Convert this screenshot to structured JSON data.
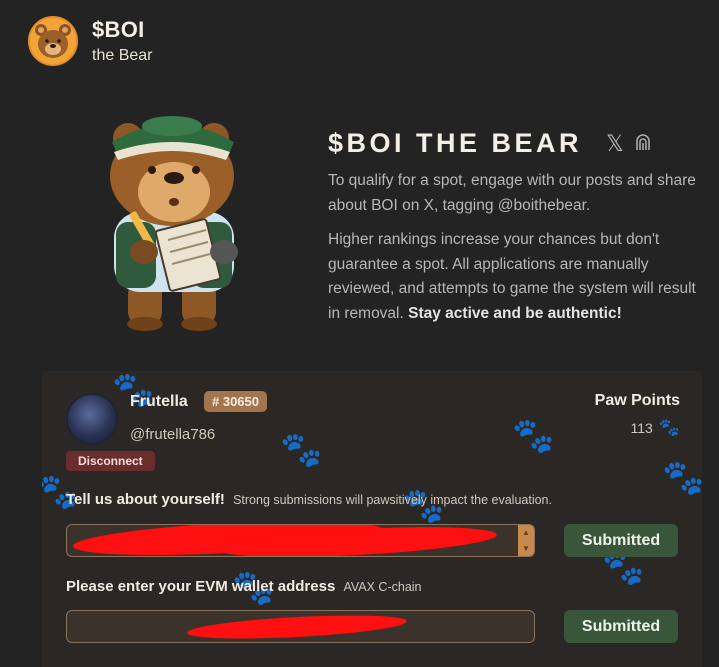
{
  "brand": {
    "title": "$BOI",
    "subtitle": "the Bear",
    "logo_icon": "bear-face-icon"
  },
  "hero": {
    "title": "$BOI THE BEAR",
    "social_icons": [
      "x-logo-icon",
      "qr-fingerprint-icon"
    ],
    "paragraph1": "To qualify for a spot, engage with our posts and share about BOI on X, tagging @boithebear.",
    "paragraph2": "Higher rankings increase your chances but don't guarantee a spot. All applications are manually reviewed, and attempts to game the system will result in removal.",
    "paragraph2_strong": "Stay active and be authentic!",
    "image_icon": "bear-mascot-writing-icon"
  },
  "profile": {
    "name": "Frutella",
    "rank": "# 30650",
    "handle": "@frutella786",
    "disconnect_label": "Disconnect",
    "points_label": "Paw Points",
    "points_value": "113"
  },
  "form": {
    "about_label": "Tell us about yourself!",
    "about_hint": "Strong submissions will pawsitively impact the evaluation.",
    "wallet_label": "Please enter your EVM wallet address",
    "wallet_hint": "AVAX C-chain",
    "submit_label_1": "Submitted",
    "submit_label_2": "Submitted"
  },
  "colors": {
    "background": "#232323",
    "card": "#2b2724",
    "rank_badge": "#a3754f",
    "disconnect": "#6b2c2e",
    "submit": "#39553a",
    "redaction": "#ff0f0f"
  }
}
